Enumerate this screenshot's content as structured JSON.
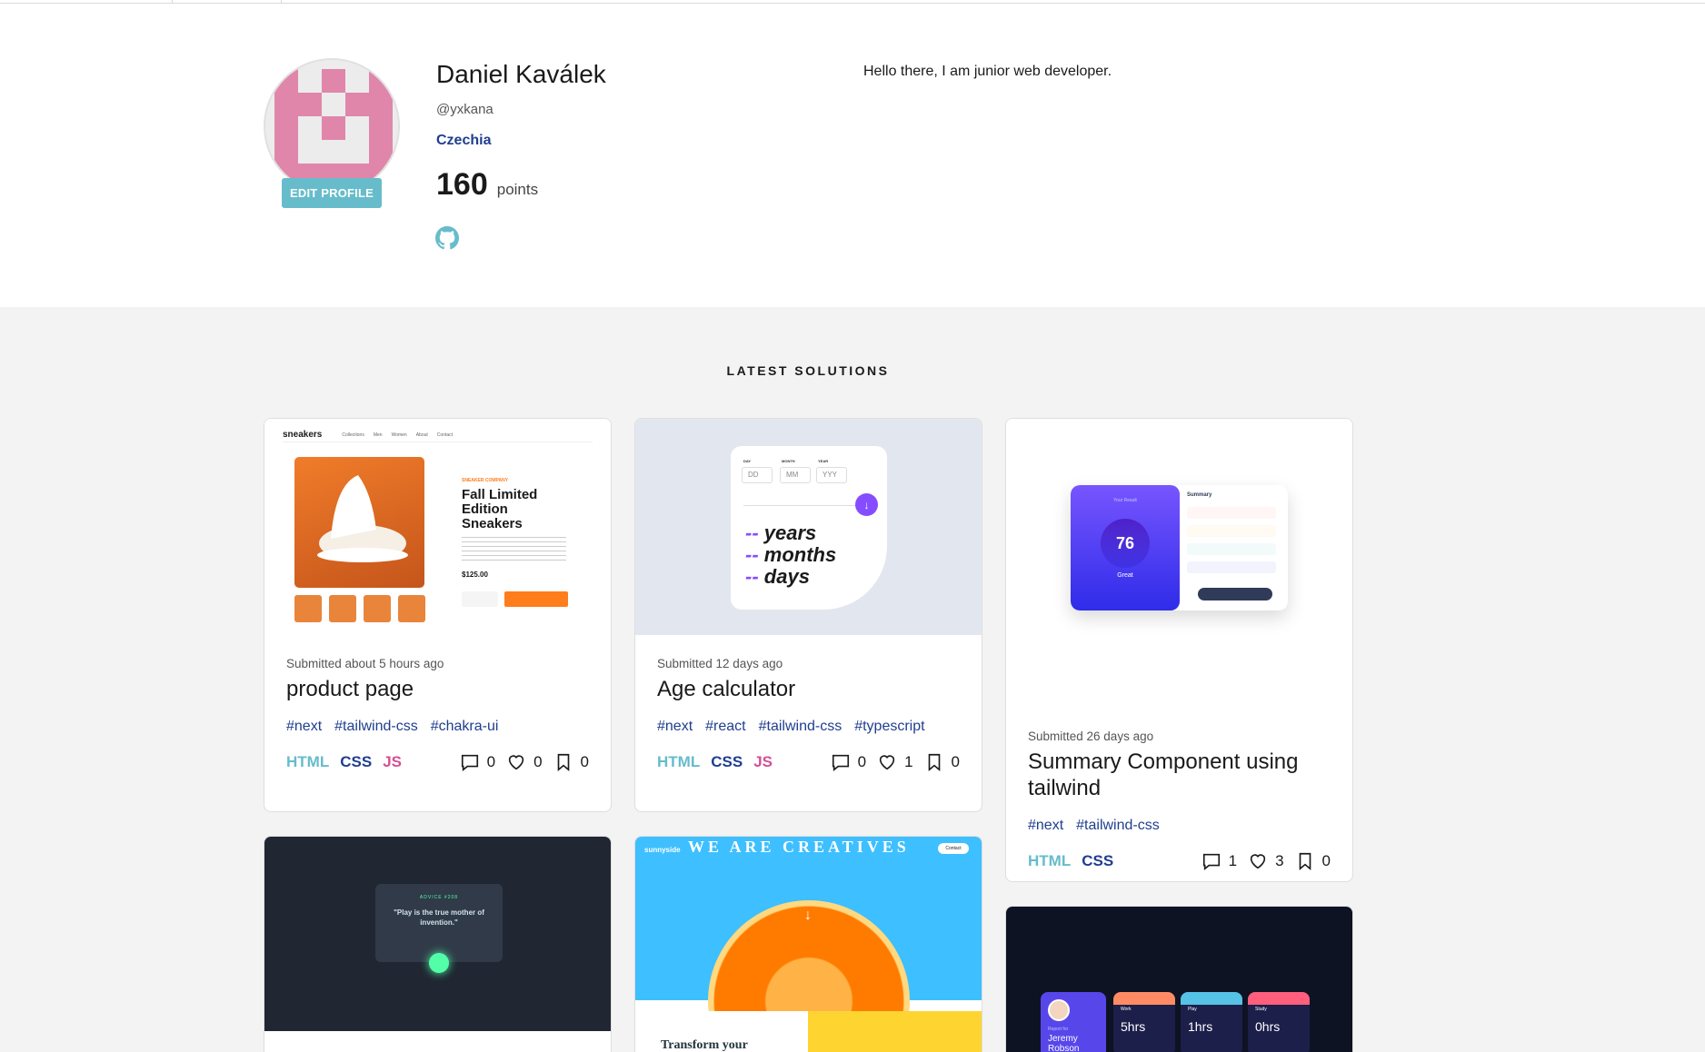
{
  "profile": {
    "name": "Daniel Kaválek",
    "handle": "@yxkana",
    "country": "Czechia",
    "points_value": "160",
    "points_label": "points",
    "bio": "Hello there, I am junior web developer.",
    "edit_label": "EDIT PROFILE",
    "github_icon": "github-icon"
  },
  "solutions": {
    "heading": "LATEST SOLUTIONS",
    "cards": [
      {
        "submitted": "Submitted about 5 hours ago",
        "title": "product page",
        "tags": [
          "#next",
          "#tailwind-css",
          "#chakra-ui"
        ],
        "langs": [
          "HTML",
          "CSS",
          "JS"
        ],
        "comments": "0",
        "likes": "0",
        "bookmarks": "0",
        "preview": {
          "logo": "sneakers",
          "nav": [
            "Collections",
            "Men",
            "Women",
            "About",
            "Contact"
          ],
          "company": "SNEAKER COMPANY",
          "title": "Fall Limited Edition Sneakers",
          "price": "$125.00"
        }
      },
      {
        "submitted": "Submitted 12 days ago",
        "title": "Age calculator",
        "tags": [
          "#next",
          "#react",
          "#tailwind-css",
          "#typescript"
        ],
        "langs": [
          "HTML",
          "CSS",
          "JS"
        ],
        "comments": "0",
        "likes": "1",
        "bookmarks": "0",
        "preview": {
          "labels": [
            "DAY",
            "MONTH",
            "YEAR"
          ],
          "placeholders": [
            "DD",
            "MM",
            "YYY"
          ],
          "lines": [
            "years",
            "months",
            "days"
          ],
          "dash": "--"
        }
      },
      {
        "submitted": "Submitted 26 days ago",
        "title": "Summary Component using tailwind",
        "tags": [
          "#next",
          "#tailwind-css"
        ],
        "langs": [
          "HTML",
          "CSS"
        ],
        "comments": "1",
        "likes": "3",
        "bookmarks": "0",
        "preview": {
          "result_label": "Your Result",
          "score": "76",
          "grade": "Great",
          "summary_label": "Summary"
        }
      },
      {
        "preview": {
          "advice_label": "ADVICE #208",
          "quote": "\"Play is the true mother of invention.\""
        }
      },
      {
        "preview": {
          "logo": "sunnyside",
          "headline": "WE ARE CREATIVES",
          "contact": "Contact",
          "transform": "Transform your"
        }
      },
      {
        "preview": {
          "report_for": "Report for",
          "person": "Jeremy Robson",
          "cards": [
            {
              "label": "Work",
              "value": "5hrs",
              "color": "#ff8b64"
            },
            {
              "label": "Play",
              "value": "1hrs",
              "color": "#55c2e6"
            },
            {
              "label": "Study",
              "value": "0hrs",
              "color": "#ff5e7d"
            }
          ]
        }
      }
    ]
  },
  "colors": {
    "accent": "#66bccb",
    "navy": "#1f3e8f",
    "js": "#d44f95",
    "avatar_pink": "#e086ab"
  }
}
